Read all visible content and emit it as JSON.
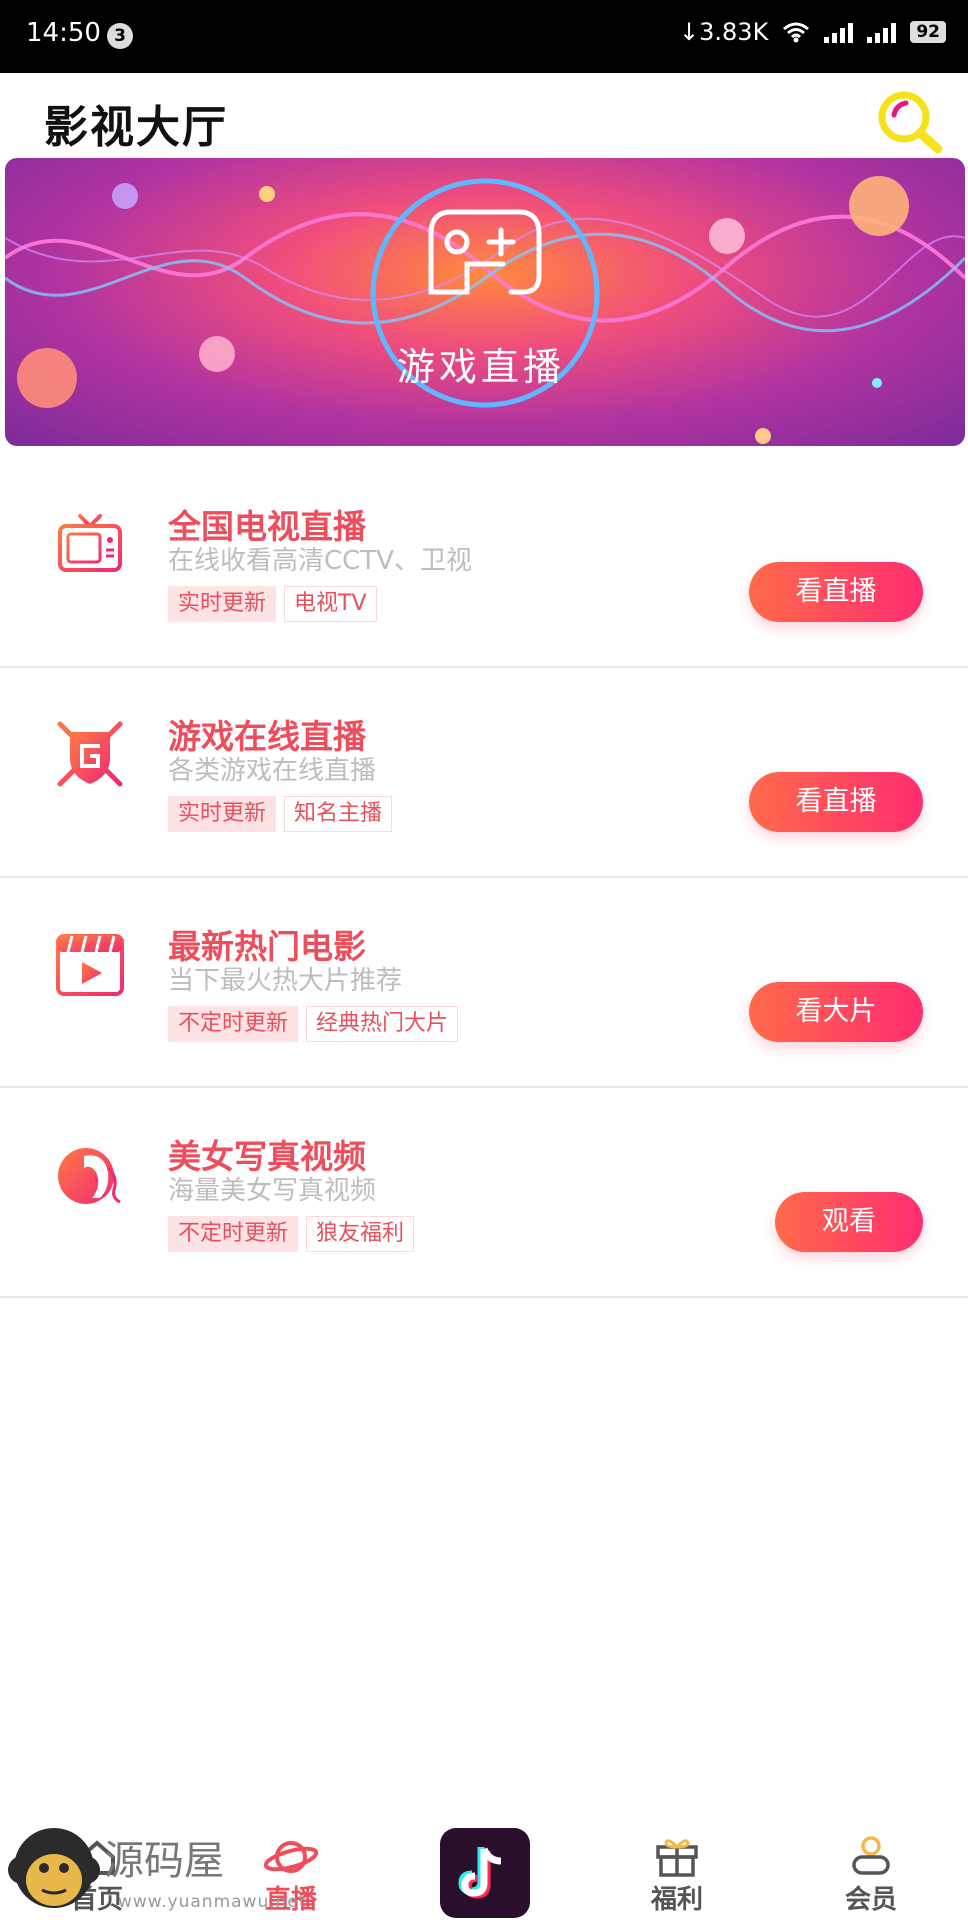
{
  "status": {
    "time": "14:50",
    "notif_count": "3",
    "speed": "↓3.83K",
    "battery": "92"
  },
  "header": {
    "title": "影视大厅"
  },
  "banner": {
    "text": "游戏直播"
  },
  "items": [
    {
      "title": "全国电视直播",
      "subtitle": "在线收看高清CCTV、卫视",
      "tags": [
        "实时更新",
        "电视TV"
      ],
      "button": "看直播",
      "icon": "tv-icon"
    },
    {
      "title": "游戏在线直播",
      "subtitle": "各类游戏在线直播",
      "tags": [
        "实时更新",
        "知名主播"
      ],
      "button": "看直播",
      "icon": "game-shield-icon"
    },
    {
      "title": "最新热门电影",
      "subtitle": "当下最火热大片推荐",
      "tags": [
        "不定时更新",
        "经典热门大片"
      ],
      "button": "看大片",
      "icon": "movie-clapper-icon"
    },
    {
      "title": "美女写真视频",
      "subtitle": "海量美女写真视频",
      "tags": [
        "不定时更新",
        "狼友福利"
      ],
      "button": "观看",
      "icon": "woman-portrait-icon"
    }
  ],
  "nav": [
    {
      "label": "首页",
      "icon": "home-icon"
    },
    {
      "label": "直播",
      "icon": "planet-icon",
      "active": true
    },
    {
      "label": "",
      "icon": "tiktok-icon"
    },
    {
      "label": "福利",
      "icon": "gift-icon"
    },
    {
      "label": "会员",
      "icon": "user-icon"
    }
  ],
  "watermark": {
    "text": "源码屋",
    "url": "www.yuanmawu.net"
  },
  "colors": {
    "accent": "#ee4d5b",
    "button_start": "#ff6a4a",
    "button_end": "#ff2d70",
    "tag_fill": "#fde3e6",
    "nav_active": "#ee4d5b",
    "nav_inactive": "#555555"
  }
}
